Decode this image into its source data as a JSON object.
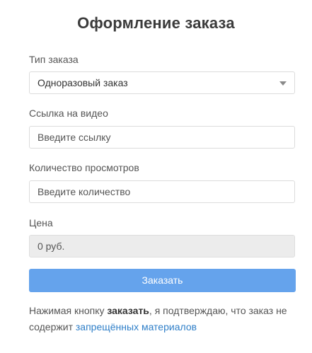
{
  "page": {
    "title": "Оформление заказа"
  },
  "order_type": {
    "label": "Тип заказа",
    "value": "Одноразовый заказ"
  },
  "video_link": {
    "label": "Ссылка на видео",
    "placeholder": "Введите ссылку"
  },
  "views_count": {
    "label": "Количество просмотров",
    "placeholder": "Введите количество"
  },
  "price": {
    "label": "Цена",
    "value": "0 руб."
  },
  "submit": {
    "label": "Заказать"
  },
  "agreement": {
    "prefix": "Нажимая кнопку ",
    "bold": "заказать",
    "middle": ", я подтверждаю, что заказ не содержит ",
    "link": "запрещённых материалов"
  }
}
